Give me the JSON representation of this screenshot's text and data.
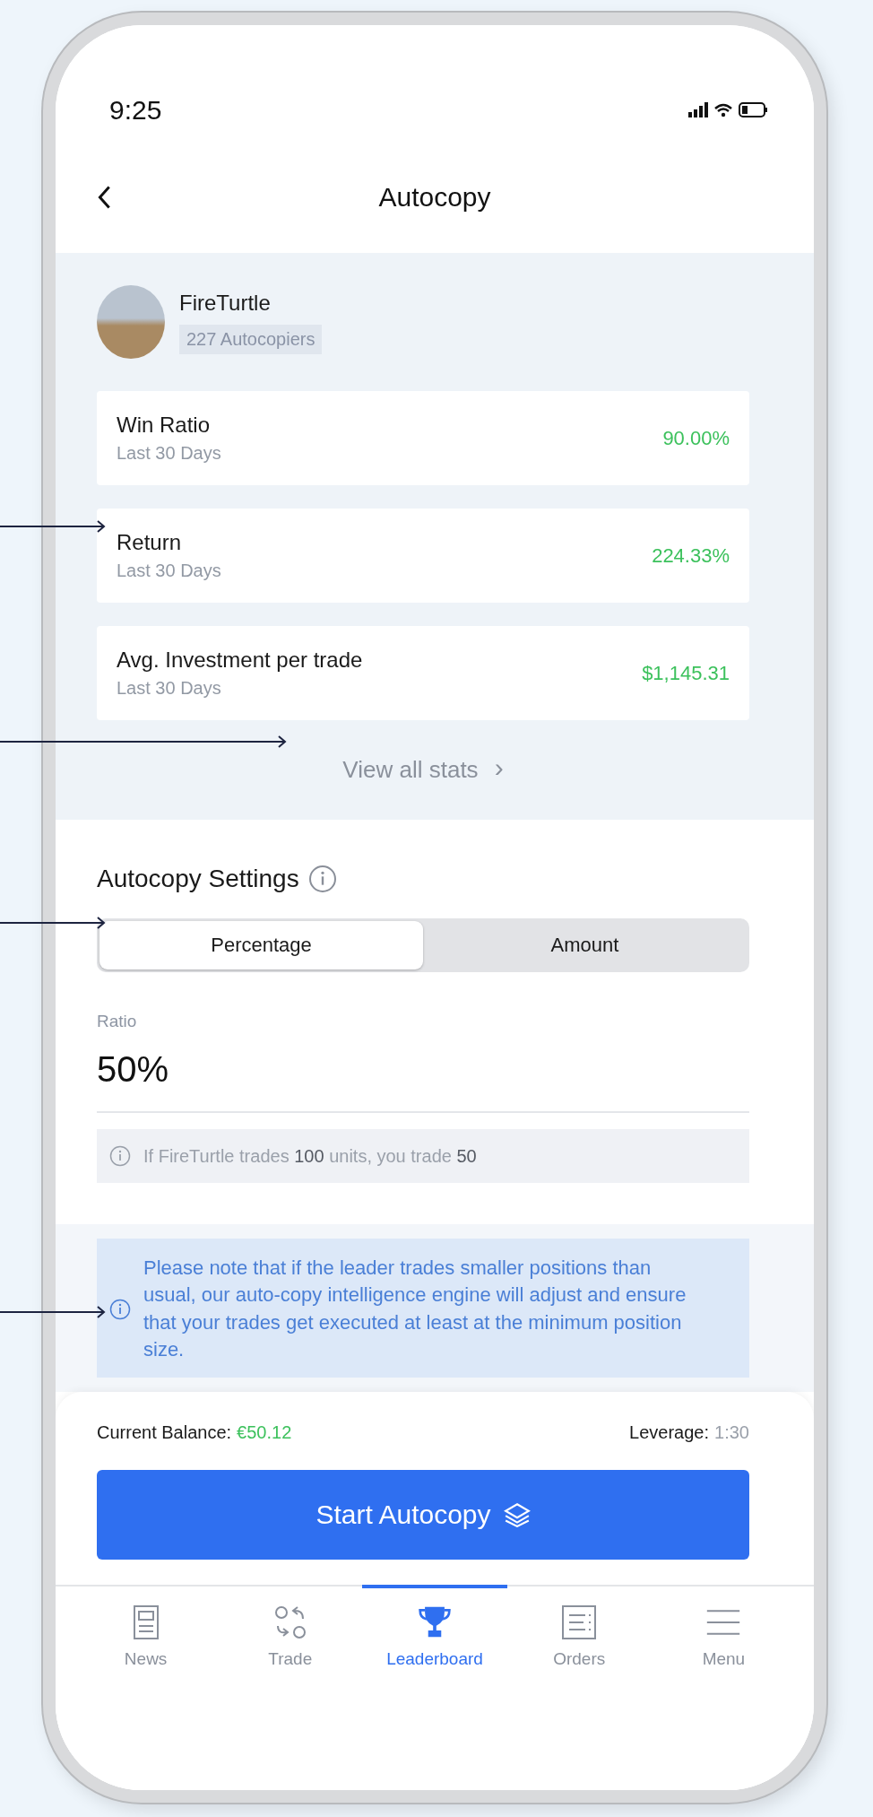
{
  "status_bar": {
    "time": "9:25"
  },
  "header": {
    "title": "Autocopy"
  },
  "leader": {
    "name": "FireTurtle",
    "autocopiers": "227 Autocopiers"
  },
  "stats": [
    {
      "label": "Win Ratio",
      "period": "Last 30 Days",
      "value": "90.00%"
    },
    {
      "label": "Return",
      "period": "Last 30 Days",
      "value": "224.33%"
    },
    {
      "label": "Avg. Investment per trade",
      "period": "Last 30 Days",
      "value": "$1,145.31"
    }
  ],
  "view_all": {
    "label": "View all stats",
    "chevron": "›"
  },
  "settings": {
    "title": "Autocopy Settings",
    "segments": [
      {
        "label": "Percentage",
        "selected": true
      },
      {
        "label": "Amount",
        "selected": false
      }
    ],
    "ratio": {
      "label": "Ratio",
      "value": "50%"
    },
    "hint": "If FireTurtle trades **100** units, you trade **50**"
  },
  "note": "Please note that if the leader trades smaller positions than usual, our auto-copy intelligence engine will adjust and ensure that your trades get executed at least at the minimum position size.",
  "footer": {
    "balance_label": "Current Balance:",
    "balance_value": "€50.12",
    "leverage_label": "Leverage:",
    "leverage_value": "1:30",
    "button": "Start Autocopy"
  },
  "nav": [
    {
      "label": "News",
      "selected": false
    },
    {
      "label": "Trade",
      "selected": false
    },
    {
      "label": "Leaderboard",
      "selected": true
    },
    {
      "label": "Orders",
      "selected": false
    },
    {
      "label": "Menu",
      "selected": false
    }
  ]
}
